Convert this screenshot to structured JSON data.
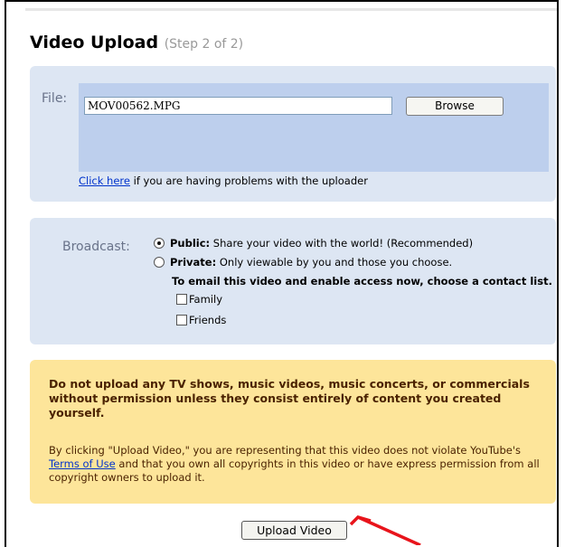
{
  "header": {
    "title": "Video Upload",
    "step": "(Step 2 of 2)"
  },
  "file": {
    "label": "File:",
    "value": "MOV00562.MPG",
    "browse_label": "Browse",
    "help_link": "Click here",
    "help_text": " if you are having problems with the uploader"
  },
  "broadcast": {
    "label": "Broadcast:",
    "options": [
      {
        "title": "Public:",
        "desc": " Share your video with the world! (Recommended)",
        "selected": true
      },
      {
        "title": "Private:",
        "desc": " Only viewable by you and those you choose.",
        "selected": false
      }
    ],
    "email_note": "To email this video and enable access now, choose a contact list.",
    "contact_lists": [
      "Family",
      "Friends"
    ]
  },
  "notice": {
    "warning": "Do not upload any TV shows, music videos, music concerts, or commercials without permission unless they consist entirely of content you created yourself.",
    "terms_before": "By clicking \"Upload Video,\" you are representing that this video does not violate YouTube's ",
    "terms_link": "Terms of Use",
    "terms_after": " and that you own all copyrights in this video or have express permission from all copyright owners to upload it."
  },
  "actions": {
    "upload_label": "Upload Video"
  },
  "colors": {
    "panel_blue": "#dde6f3",
    "file_zone_blue": "#bdcfed",
    "notice_yellow": "#fde59a",
    "link_blue": "#0033cc",
    "arrow_red": "#e8141b"
  },
  "icons": [
    "radio-selected-icon",
    "radio-unselected-icon",
    "checkbox-icon",
    "red-arrow-annotation"
  ]
}
